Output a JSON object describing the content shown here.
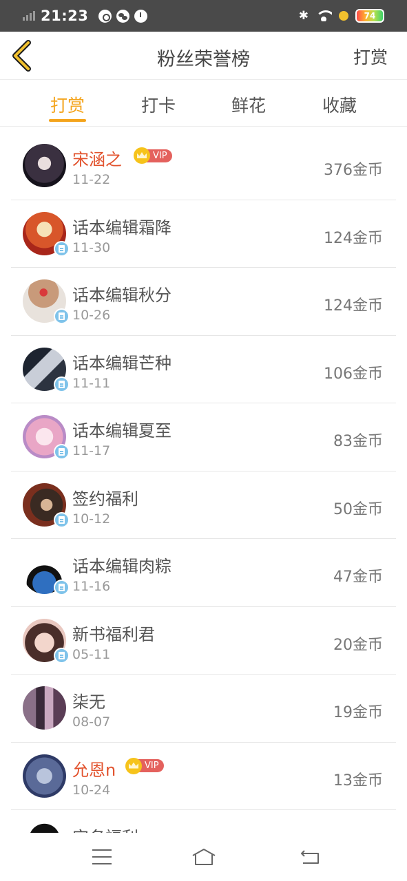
{
  "status_bar": {
    "time": "21:23",
    "battery_level": "74",
    "icons": [
      "signal-icon",
      "media-icon",
      "wechat-icon",
      "alarm-icon",
      "bluetooth-icon",
      "wifi-icon",
      "charging-icon",
      "battery-icon"
    ]
  },
  "nav": {
    "back_icon": "chevron-left-icon",
    "title": "粉丝荣誉榜",
    "action": "打赏"
  },
  "tabs": [
    {
      "label": "打赏",
      "active": true
    },
    {
      "label": "打卡",
      "active": false
    },
    {
      "label": "鲜花",
      "active": false
    },
    {
      "label": "收藏",
      "active": false
    }
  ],
  "vip_label": "VIP",
  "rows": [
    {
      "name": "宋涵之",
      "date": "11-22",
      "amount": "376金币",
      "vip": true,
      "editor_badge": false
    },
    {
      "name": "话本编辑霜降",
      "date": "11-30",
      "amount": "124金币",
      "vip": false,
      "editor_badge": true
    },
    {
      "name": "话本编辑秋分",
      "date": "10-26",
      "amount": "124金币",
      "vip": false,
      "editor_badge": true
    },
    {
      "name": "话本编辑芒种",
      "date": "11-11",
      "amount": "106金币",
      "vip": false,
      "editor_badge": true
    },
    {
      "name": "话本编辑夏至",
      "date": "11-17",
      "amount": "83金币",
      "vip": false,
      "editor_badge": true
    },
    {
      "name": "签约福利",
      "date": "10-12",
      "amount": "50金币",
      "vip": false,
      "editor_badge": true
    },
    {
      "name": "话本编辑肉粽",
      "date": "11-16",
      "amount": "47金币",
      "vip": false,
      "editor_badge": true
    },
    {
      "name": "新书福利君",
      "date": "05-11",
      "amount": "20金币",
      "vip": false,
      "editor_badge": true
    },
    {
      "name": "柒无",
      "date": "08-07",
      "amount": "19金币",
      "vip": false,
      "editor_badge": false
    },
    {
      "name": "允恩n",
      "date": "10-24",
      "amount": "13金币",
      "vip": true,
      "editor_badge": false
    },
    {
      "name": "实名福利",
      "date": "",
      "amount": "",
      "vip": false,
      "editor_badge": false
    }
  ],
  "bottom_nav": {
    "icons": [
      "menu-icon",
      "home-icon",
      "back-icon"
    ]
  },
  "colors": {
    "accent": "#f4a41c",
    "vip_name": "#e2532e",
    "vip_tag": "#e4615d",
    "editor_badge": "#7fc3ea",
    "status_bar": "#4a4a4a"
  }
}
